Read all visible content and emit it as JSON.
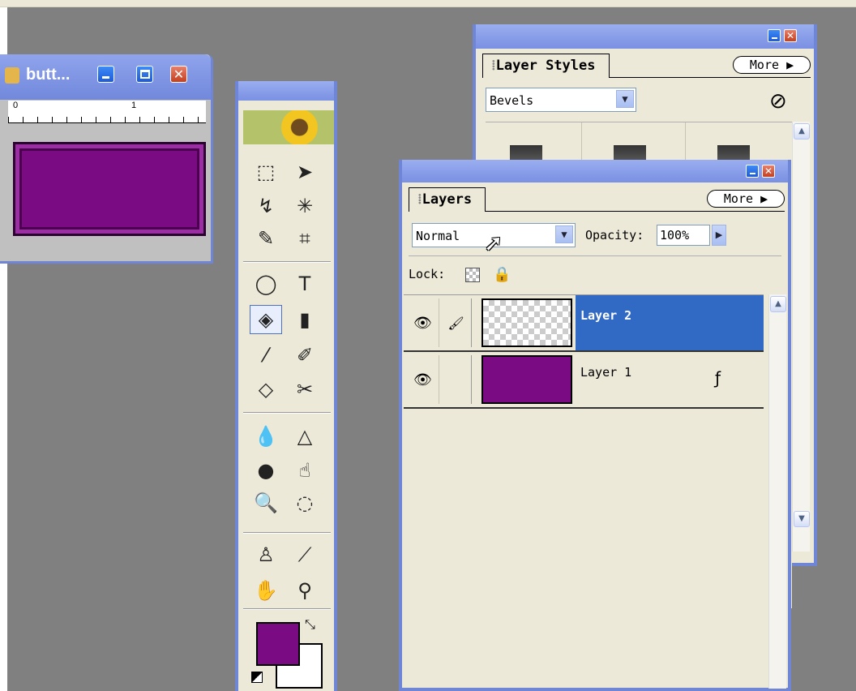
{
  "document_window": {
    "title": "butt...",
    "ruler_marks": [
      "0",
      "1"
    ],
    "button_color": "#7a0b82"
  },
  "toolbox": {
    "tools": [
      {
        "name": "marquee-tool",
        "glyph": "⬚"
      },
      {
        "name": "move-tool",
        "glyph": "➤"
      },
      {
        "name": "lasso-tool",
        "glyph": "↯"
      },
      {
        "name": "magic-wand-tool",
        "glyph": "✳"
      },
      {
        "name": "brush-select-tool",
        "glyph": "✎"
      },
      {
        "name": "crop-tool",
        "glyph": "⌗"
      },
      {
        "name": "shape-tool",
        "glyph": "◯"
      },
      {
        "name": "type-tool",
        "glyph": "T"
      },
      {
        "name": "paint-bucket-tool",
        "glyph": "◈"
      },
      {
        "name": "gradient-tool",
        "glyph": "▮"
      },
      {
        "name": "brush-tool",
        "glyph": "⁄"
      },
      {
        "name": "pencil-tool",
        "glyph": "✐"
      },
      {
        "name": "eraser-tool",
        "glyph": "◇"
      },
      {
        "name": "red-eye-tool",
        "glyph": "✂"
      },
      {
        "name": "blur-tool",
        "glyph": "💧"
      },
      {
        "name": "sharpen-tool",
        "glyph": "△"
      },
      {
        "name": "sponge-tool",
        "glyph": "●"
      },
      {
        "name": "smudge-tool",
        "glyph": "☝"
      },
      {
        "name": "burn-tool",
        "glyph": "🔍"
      },
      {
        "name": "dodge-tool",
        "glyph": "◌"
      },
      {
        "name": "clone-stamp-tool",
        "glyph": "♙"
      },
      {
        "name": "eyedropper-tool",
        "glyph": "⟋"
      },
      {
        "name": "hand-tool",
        "glyph": "✋"
      },
      {
        "name": "zoom-tool",
        "glyph": "⚲"
      }
    ],
    "foreground_color": "#7a0b82",
    "background_color": "#ffffff"
  },
  "layer_styles": {
    "tab_label": "Layer Styles",
    "more_label": "More",
    "category": "Bevels"
  },
  "layers": {
    "tab_label": "Layers",
    "more_label": "More",
    "blend_mode": "Normal",
    "opacity_label": "Opacity:",
    "opacity_value": "100%",
    "lock_label": "Lock:",
    "items": [
      {
        "name": "Layer 2",
        "selected": true,
        "has_effects": false
      },
      {
        "name": "Layer 1",
        "selected": false,
        "has_effects": true
      }
    ]
  },
  "colors": {
    "xp_title": "#7a90e2",
    "selection": "#316ac5",
    "palette_bg": "#ece9d8"
  }
}
